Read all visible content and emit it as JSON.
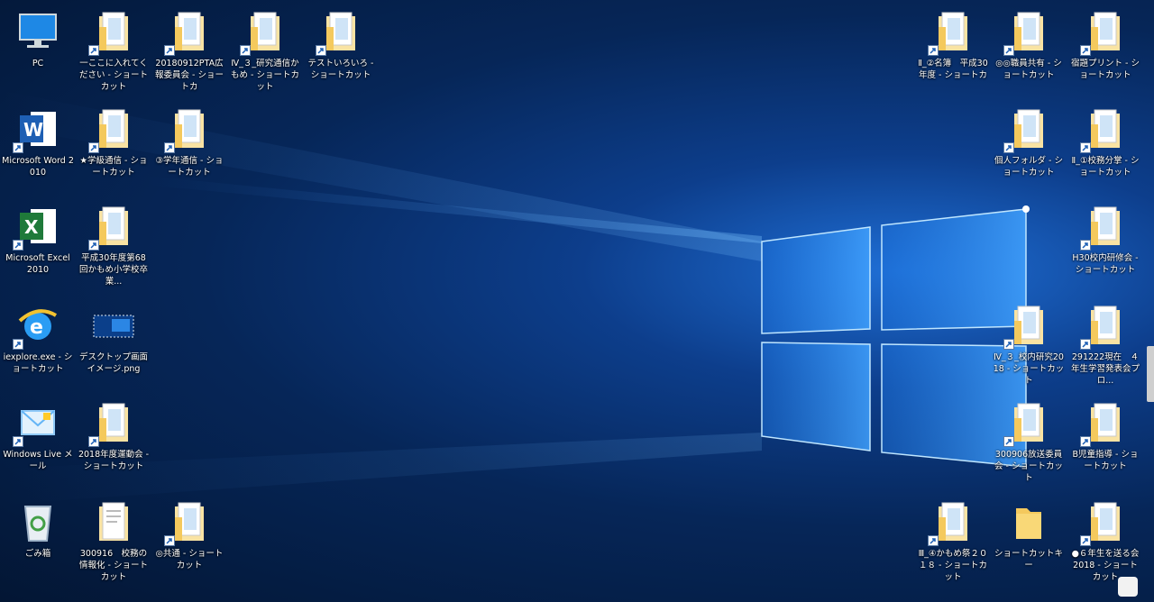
{
  "desktop": {
    "icons": [
      {
        "name": "pc",
        "label": "PC",
        "art": "pc",
        "shortcut": false
      },
      {
        "name": "word",
        "label": "Microsoft Word 2010",
        "art": "word",
        "shortcut": true
      },
      {
        "name": "excel",
        "label": "Microsoft Excel 2010",
        "art": "excel",
        "shortcut": true
      },
      {
        "name": "iexplore",
        "label": "iexplore.exe - ショートカット",
        "art": "ie",
        "shortcut": true
      },
      {
        "name": "winlive-mail",
        "label": "Windows Live メール",
        "art": "mail",
        "shortcut": true
      },
      {
        "name": "recycle-bin",
        "label": "ごみ箱",
        "art": "recycle",
        "shortcut": false
      },
      {
        "name": "folder-kokoni",
        "label": "一ここに入れてください - ショートカット",
        "art": "folder",
        "shortcut": true
      },
      {
        "name": "folder-gakkyu",
        "label": "★学級通信 - ショートカット",
        "art": "folder",
        "shortcut": true
      },
      {
        "name": "folder-h30-68",
        "label": "平成30年度第68回かもめ小学校卒業...",
        "art": "folder",
        "shortcut": true
      },
      {
        "name": "desktop-image",
        "label": "デスクトップ画面イメージ.png",
        "art": "image",
        "shortcut": false
      },
      {
        "name": "folder-undokai",
        "label": "2018年度運動会 - ショートカット",
        "art": "folder",
        "shortcut": true
      },
      {
        "name": "folder-300916",
        "label": "300916　校務の情報化 - ショートカット",
        "art": "doc",
        "shortcut": false
      },
      {
        "name": "folder-pta",
        "label": "20180912PTA広報委員会 - ショートカ",
        "art": "folder",
        "shortcut": true
      },
      {
        "name": "folder-gakunen",
        "label": "③学年通信 - ショートカット",
        "art": "folder",
        "shortcut": true
      },
      {
        "name": "folder-kyotsu",
        "label": "◎共通 - ショートカット",
        "art": "folder",
        "shortcut": true
      },
      {
        "name": "folder-kenkyu",
        "label": "Ⅳ_３_研究通信かもめ - ショートカット",
        "art": "folder",
        "shortcut": true
      },
      {
        "name": "folder-test",
        "label": "テストいろいろ - ショートカット",
        "art": "folder",
        "shortcut": true
      },
      {
        "name": "folder-meibo",
        "label": "Ⅱ_②名簿　平成30年度 - ショートカ",
        "art": "folder",
        "shortcut": true
      },
      {
        "name": "folder-shokuin",
        "label": "◎◎職員共有 - ショートカット",
        "art": "folder",
        "shortcut": true
      },
      {
        "name": "folder-iii-kamome",
        "label": "Ⅲ_④かもめ祭２０１８ - ショートカット",
        "art": "folder",
        "shortcut": true
      },
      {
        "name": "folder-shukudai",
        "label": "宿題プリント - ショートカット",
        "art": "folder",
        "shortcut": true
      },
      {
        "name": "folder-kojin",
        "label": "個人フォルダ - ショートカット",
        "art": "folder",
        "shortcut": true
      },
      {
        "name": "folder-komu",
        "label": "Ⅱ_①校務分掌 - ショートカット",
        "art": "folder",
        "shortcut": true
      },
      {
        "name": "folder-h30-kenshu",
        "label": "H30校内研修会 - ショートカット",
        "art": "folder",
        "shortcut": true
      },
      {
        "name": "folder-iv-kenkyu",
        "label": "Ⅳ_３_校内研究2018 - ショートカット",
        "art": "folder",
        "shortcut": true
      },
      {
        "name": "folder-291222",
        "label": "291222現在　４年生学習発表会プロ...",
        "art": "folder",
        "shortcut": true
      },
      {
        "name": "folder-300906",
        "label": "300906放送委員会 - ショートカット",
        "art": "folder",
        "shortcut": true
      },
      {
        "name": "folder-jido",
        "label": "B児童指導 - ショートカット",
        "art": "folder",
        "shortcut": true
      },
      {
        "name": "folder-shortcut-key",
        "label": "ショートカットキー",
        "art": "plainfolder",
        "shortcut": false
      },
      {
        "name": "folder-6nen",
        "label": "●６年生を送る会2018 - ショートカット",
        "art": "folder",
        "shortcut": true
      }
    ]
  }
}
